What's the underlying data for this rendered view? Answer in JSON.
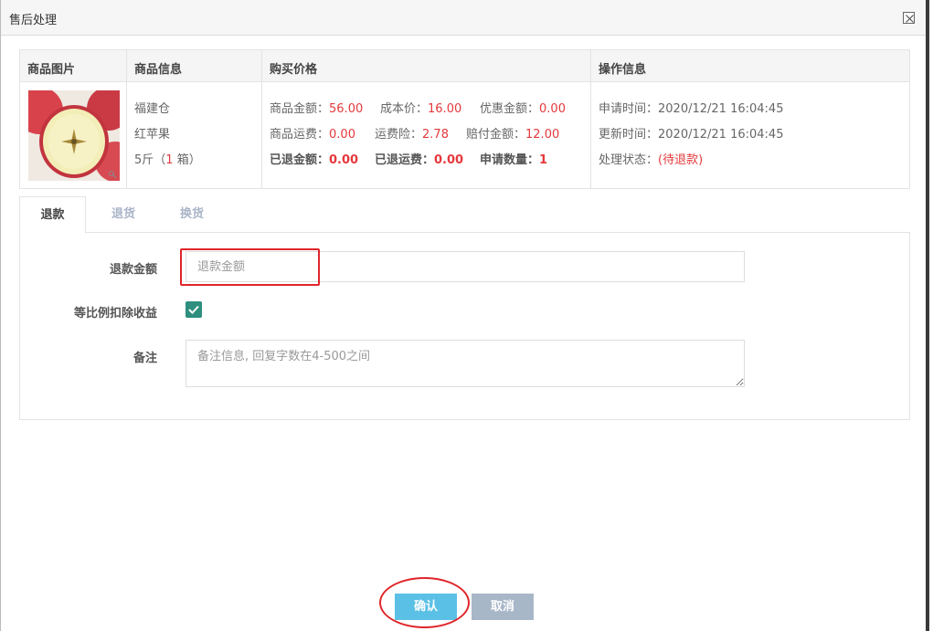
{
  "dialog": {
    "title": "售后处理",
    "close_icon": "close-icon"
  },
  "table": {
    "headers": {
      "image": "商品图片",
      "info": "商品信息",
      "price": "购买价格",
      "operation": "操作信息"
    },
    "info": {
      "warehouse": "福建仓",
      "name": "红苹果",
      "spec_prefix": "5斤（",
      "spec_qty": "1",
      "spec_suffix": " 箱）"
    },
    "price": {
      "goods_amount_label": "商品金额：",
      "goods_amount": "56.00",
      "cost_label": "成本价：",
      "cost": "16.00",
      "discount_label": "优惠金额：",
      "discount": "0.00",
      "freight_label": "商品运费：",
      "freight": "0.00",
      "freight_insurance_label": "运费险：",
      "freight_insurance": "2.78",
      "compensation_label": "赔付金额：",
      "compensation": "12.00",
      "refunded_amount_label": "已退金额：",
      "refunded_amount": "0.00",
      "refunded_freight_label": "已退运费：",
      "refunded_freight": "0.00",
      "apply_qty_label": "申请数量：",
      "apply_qty": "1"
    },
    "operation": {
      "apply_time_label": "申请时间：",
      "apply_time": "2020/12/21 16:04:45",
      "update_time_label": "更新时间：",
      "update_time": "2020/12/21 16:04:45",
      "status_label": "处理状态：",
      "status": "(待退款)"
    }
  },
  "tabs": [
    {
      "label": "退款"
    },
    {
      "label": "退货"
    },
    {
      "label": "换货"
    }
  ],
  "form": {
    "refund_amount_label": "退款金额",
    "refund_amount_placeholder": "退款金额",
    "refund_amount_value": "",
    "proportional_label": "等比例扣除收益",
    "proportional_checked": true,
    "remark_label": "备注",
    "remark_placeholder": "备注信息, 回复字数在4-500之间"
  },
  "buttons": {
    "confirm": "确认",
    "cancel": "取消"
  },
  "colors": {
    "accent_red": "#e4393c",
    "confirm_bg": "#5bc0e6",
    "cancel_bg": "#a8b7c8",
    "checkbox": "#2f8f7f"
  }
}
